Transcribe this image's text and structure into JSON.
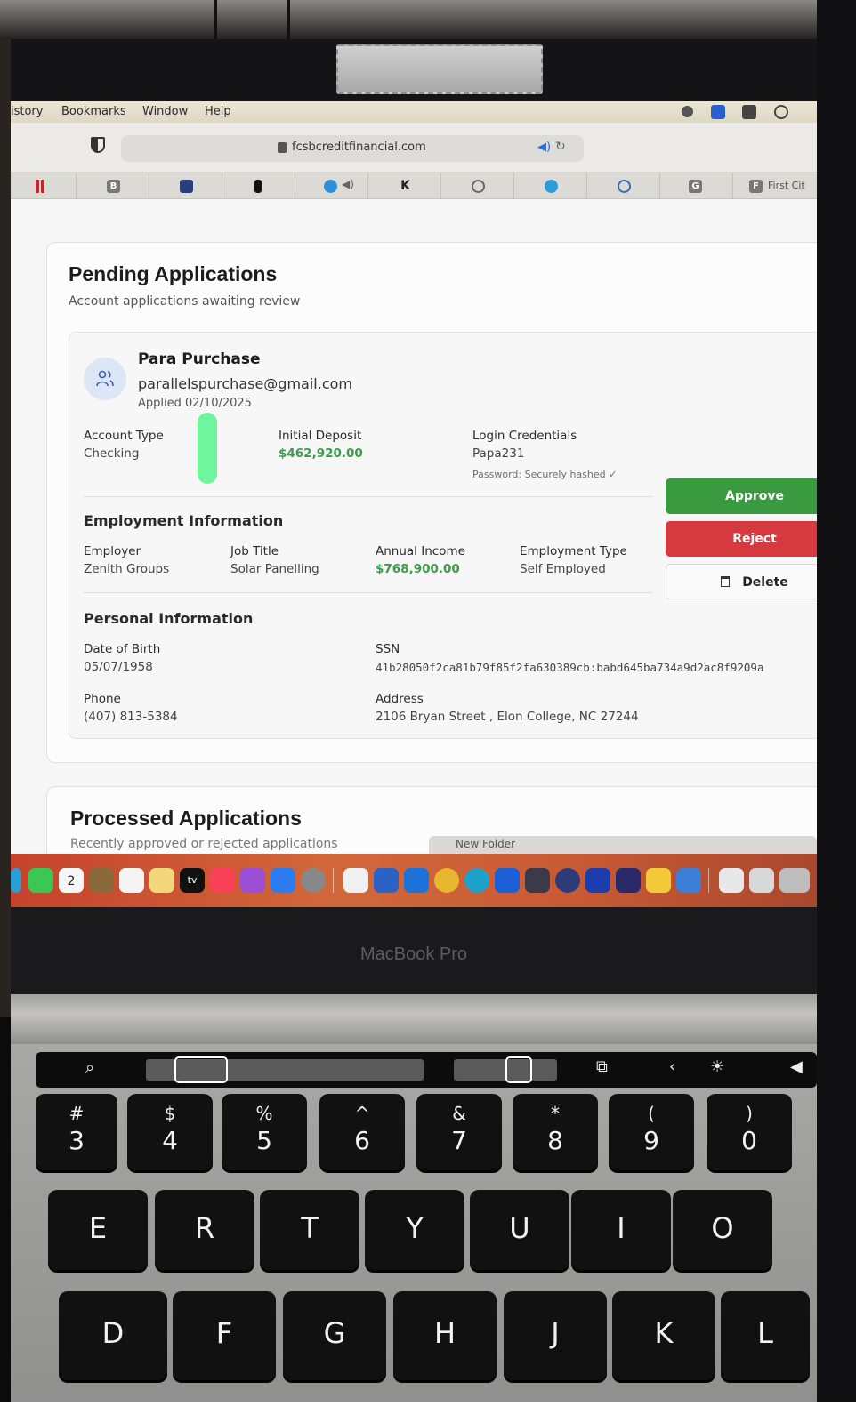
{
  "menubar": {
    "items": [
      "istory",
      "Bookmarks",
      "Window",
      "Help"
    ]
  },
  "browser": {
    "url": "fcsbcreditfinancial.com",
    "tab_last_label": "First Cit",
    "tab_badges": [
      "B",
      "K",
      "G",
      "F"
    ]
  },
  "pending": {
    "title": "Pending Applications",
    "subtitle": "Account applications awaiting review",
    "applicant": {
      "name": "Para Purchase",
      "email": "parallelspurchase@gmail.com",
      "applied": "Applied 02/10/2025"
    },
    "account": {
      "account_type_label": "Account Type",
      "account_type": "Checking",
      "deposit_label": "Initial Deposit",
      "deposit": "$462,920.00",
      "credentials_label": "Login Credentials",
      "username": "Papa231",
      "password_note": "Password: Securely hashed ✓"
    },
    "employment": {
      "heading": "Employment Information",
      "employer_label": "Employer",
      "employer": "Zenith Groups",
      "job_title_label": "Job Title",
      "job_title": "Solar Panelling",
      "income_label": "Annual Income",
      "income": "$768,900.00",
      "type_label": "Employment Type",
      "type": "Self Employed"
    },
    "personal": {
      "heading": "Personal Information",
      "dob_label": "Date of Birth",
      "dob": "05/07/1958",
      "ssn_label": "SSN",
      "ssn": "41b28050f2ca81b79f85f2fa630389cb:babd645ba734a9d2ac8f9209a",
      "phone_label": "Phone",
      "phone": "(407) 813-5384",
      "address_label": "Address",
      "address": "2106 Bryan Street , Elon College, NC 27244"
    },
    "actions": {
      "approve": "Approve",
      "reject": "Reject",
      "delete": "Delete"
    }
  },
  "processed": {
    "title": "Processed Applications",
    "subtitle": "Recently approved or rejected applications"
  },
  "finder_strip": "New Folder",
  "dock": {
    "calendar_day": "2",
    "tv_label": "tv"
  },
  "hardware_label": "MacBook Pro",
  "keyboard": {
    "number_row": [
      {
        "sym": "#",
        "main": "3"
      },
      {
        "sym": "$",
        "main": "4"
      },
      {
        "sym": "%",
        "main": "5"
      },
      {
        "sym": "^",
        "main": "6"
      },
      {
        "sym": "&",
        "main": "7"
      },
      {
        "sym": "*",
        "main": "8"
      },
      {
        "sym": "(",
        "main": "9"
      },
      {
        "sym": ")",
        "main": "0"
      }
    ],
    "top_row": [
      "E",
      "R",
      "T",
      "Y",
      "U",
      "I",
      "O"
    ],
    "home_row": [
      "D",
      "F",
      "G",
      "H",
      "J",
      "K",
      "L"
    ]
  },
  "colors": {
    "approve": "#3a9a40",
    "reject": "#d63a3f",
    "money_green": "#3d9a4a",
    "highlighter": "#5ff591"
  }
}
